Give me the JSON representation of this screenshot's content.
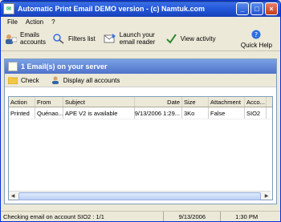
{
  "window": {
    "title": "Automatic Print Email DEMO version - (c) Namtuk.com"
  },
  "menu": [
    "File",
    "Action",
    "?"
  ],
  "toolbar": {
    "emails_accounts": "Emails accounts",
    "filters_list": "Filters list",
    "launch_email_reader": "Launch your email reader",
    "view_activity": "View activity",
    "quick_help": "Quick Help"
  },
  "panel": {
    "title": "1 Email(s) on your server",
    "check": "Check",
    "display_all": "Display all accounts"
  },
  "grid": {
    "columns": [
      "Action",
      "From",
      "Subject",
      "Date",
      "Size",
      "Attachment",
      "Acco..."
    ],
    "rows": [
      [
        "Printed",
        "Quénao...",
        "APE V2 is available",
        "9/13/2006 1:29...",
        "3Ko",
        "False",
        "SIO2"
      ]
    ]
  },
  "status": {
    "message": "Checking email on account SIO2 : 1/1",
    "date": "9/13/2006",
    "time": "1:30 PM"
  }
}
